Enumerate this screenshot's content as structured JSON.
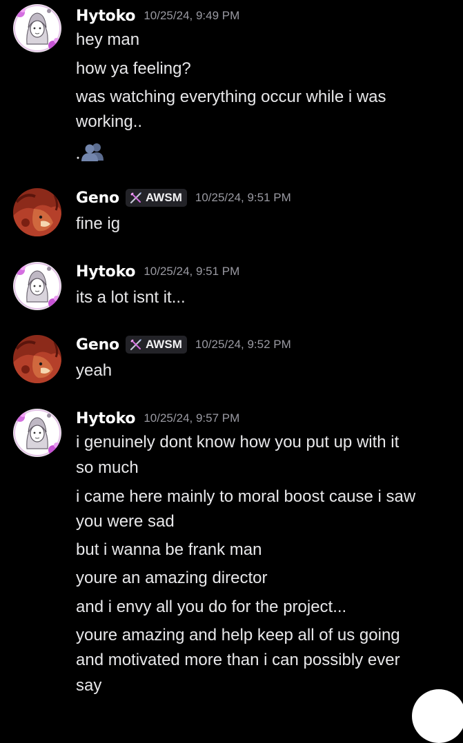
{
  "colors": {
    "background": "#000000",
    "username": "#ffffff",
    "timestamp": "#9a9aa2",
    "text": "#e8e8ea",
    "tag_bg": "#232328"
  },
  "messages": [
    {
      "author": "Hytoko",
      "avatar": "hytoko-avatar",
      "timestamp": "10/25/24, 9:49 PM",
      "lines": [
        "hey man",
        "how ya feeling?",
        "was watching everything occur while i was",
        "working.."
      ],
      "emoji": "busts-in-silhouette-emoji"
    },
    {
      "author": "Geno",
      "avatar": "geno-avatar",
      "tag": "AWSM",
      "tag_icon": "crossed-swords-icon",
      "timestamp": "10/25/24, 9:51 PM",
      "lines": [
        "fine ig"
      ]
    },
    {
      "author": "Hytoko",
      "avatar": "hytoko-avatar",
      "timestamp": "10/25/24, 9:51 PM",
      "lines": [
        "its a lot isnt it..."
      ]
    },
    {
      "author": "Geno",
      "avatar": "geno-avatar",
      "tag": "AWSM",
      "tag_icon": "crossed-swords-icon",
      "timestamp": "10/25/24, 9:52 PM",
      "lines": [
        "yeah"
      ]
    },
    {
      "author": "Hytoko",
      "avatar": "hytoko-avatar",
      "timestamp": "10/25/24, 9:57 PM",
      "lines": [
        "i genuinely dont know how you put up with it",
        "so much",
        "i came here mainly to moral boost cause i saw",
        "you were sad",
        "but i wanna be frank man",
        "youre an amazing director",
        "and i envy all you do for the project...",
        "youre amazing and help keep all of us going",
        "and motivated more than i can possibly ever",
        "say"
      ]
    }
  ]
}
